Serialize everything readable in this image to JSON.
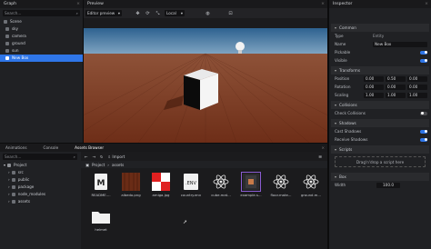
{
  "graph": {
    "title": "Graph",
    "search_placeholder": "Search...",
    "items": [
      {
        "label": "Scene",
        "icon": "scene-icon"
      },
      {
        "label": "sky",
        "icon": "entity-icon"
      },
      {
        "label": "camera",
        "icon": "camera-icon"
      },
      {
        "label": "ground",
        "icon": "entity-icon"
      },
      {
        "label": "sun",
        "icon": "light-icon"
      },
      {
        "label": "New Box",
        "icon": "entity-icon",
        "selected": true
      }
    ]
  },
  "preview": {
    "title": "Preview",
    "camera_select": "Editor preview",
    "space_select": "Local"
  },
  "inspector": {
    "title": "Inspector",
    "common": {
      "section": "Common",
      "type_label": "Type",
      "type_value": "Entity",
      "name_label": "Name",
      "name_value": "New Box",
      "pickable_label": "Pickable",
      "visible_label": "Visible"
    },
    "transforms": {
      "section": "Transforms",
      "position_label": "Position",
      "position": [
        "0.00",
        "0.50",
        "0.00"
      ],
      "rotation_label": "Rotation",
      "rotation": [
        "0.00",
        "0.00",
        "0.00"
      ],
      "scaling_label": "Scaling",
      "scaling": [
        "1.00",
        "1.00",
        "1.00"
      ]
    },
    "collisions": {
      "section": "Collisions",
      "check_label": "Check Collisions"
    },
    "shadows": {
      "section": "Shadows",
      "cast_label": "Cast Shadows",
      "receive_label": "Receive Shadows"
    },
    "scripts": {
      "section": "Scripts",
      "drop_text": "Drag'n'drop a script here"
    },
    "box": {
      "section": "Box",
      "width_label": "Width",
      "width_value": "100.0"
    }
  },
  "bottom": {
    "tabs": [
      "Animations",
      "Console",
      "Assets Browser"
    ],
    "project": {
      "search_placeholder": "Search...",
      "root": "Project",
      "folders": [
        "src",
        "public",
        "package",
        "node_modules",
        "assets"
      ]
    },
    "assets": {
      "import_label": "Import",
      "breadcrumb": [
        "Project",
        "assets"
      ],
      "files": [
        {
          "name": "README....",
          "kind": "markdown"
        },
        {
          "name": "albedo.png",
          "kind": "wood"
        },
        {
          "name": "amiga.jpg",
          "kind": "checker"
        },
        {
          "name": "country.env",
          "kind": "env"
        },
        {
          "name": "cube.mat...",
          "kind": "react"
        },
        {
          "name": "example.s...",
          "kind": "script",
          "selected": true
        },
        {
          "name": "floor.mate...",
          "kind": "react"
        },
        {
          "name": "ground.m...",
          "kind": "react"
        },
        {
          "name": "helmet",
          "kind": "folder"
        }
      ]
    }
  },
  "colors": {
    "accent": "#2f76e8",
    "panel": "#202124",
    "sky_top": "#2a5b86",
    "ground": "#7a3a20"
  }
}
